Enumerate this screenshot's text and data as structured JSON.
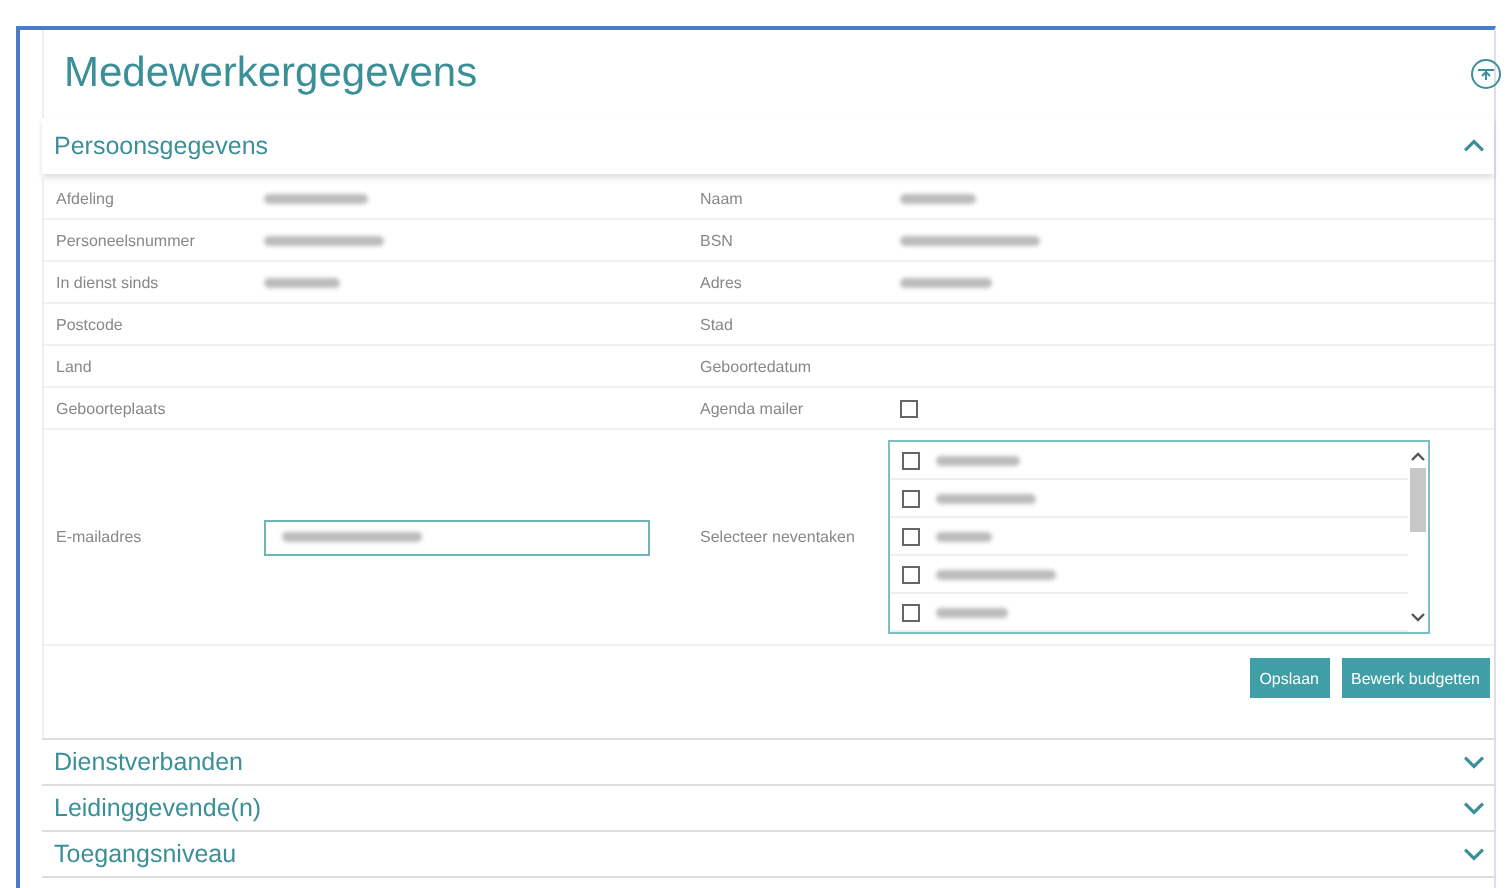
{
  "page": {
    "title": "Medewerkergegevens"
  },
  "sections": [
    {
      "title": "Persoonsgegevens",
      "expanded": true,
      "rows": [
        {
          "cells": [
            {
              "kind": "text",
              "label": "Afdeling",
              "value_blurred": true
            },
            {
              "kind": "text",
              "label": "Naam",
              "value_blurred": true
            }
          ]
        },
        {
          "cells": [
            {
              "kind": "text",
              "label": "Personeelsnummer",
              "value_blurred": true
            },
            {
              "kind": "text",
              "label": "BSN",
              "value_blurred": true
            }
          ]
        },
        {
          "cells": [
            {
              "kind": "text",
              "label": "In dienst sinds",
              "value_blurred": true
            },
            {
              "kind": "text",
              "label": "Adres",
              "value_blurred": true
            }
          ]
        },
        {
          "cells": [
            {
              "kind": "text",
              "label": "Postcode",
              "value_blurred": false
            },
            {
              "kind": "text",
              "label": "Stad",
              "value_blurred": false
            }
          ]
        },
        {
          "cells": [
            {
              "kind": "text",
              "label": "Land",
              "value_blurred": false
            },
            {
              "kind": "text",
              "label": "Geboortedatum",
              "value_blurred": false
            }
          ]
        },
        {
          "cells": [
            {
              "kind": "text",
              "label": "Geboorteplaats",
              "value_blurred": false
            },
            {
              "kind": "checkbox",
              "label": "Agenda mailer",
              "checked": false
            }
          ]
        },
        {
          "cells": [
            {
              "kind": "input",
              "label": "E-mailadres",
              "value_blurred": true
            },
            {
              "kind": "checklist",
              "label": "Selecteer neventaken",
              "items": [
                {
                  "checked": false,
                  "blurred": true
                },
                {
                  "checked": false,
                  "blurred": true
                },
                {
                  "checked": false,
                  "blurred": true
                },
                {
                  "checked": false,
                  "blurred": true
                },
                {
                  "checked": false,
                  "blurred": true
                }
              ]
            }
          ]
        }
      ],
      "buttons": [
        "Opslaan",
        "Bewerk budgetten"
      ]
    },
    {
      "title": "Dienstverbanden",
      "expanded": false
    },
    {
      "title": "Leidinggevende(n)",
      "expanded": false
    },
    {
      "title": "Toegangsniveau",
      "expanded": false
    }
  ]
}
